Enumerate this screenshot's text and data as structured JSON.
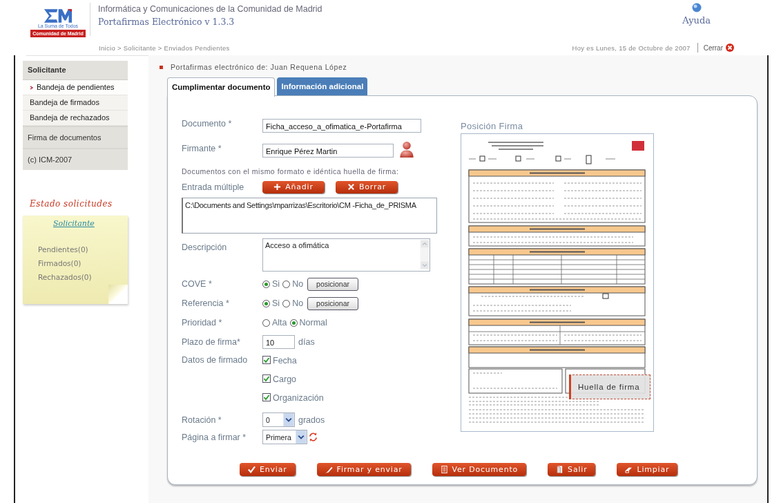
{
  "header": {
    "logo_tagline": "La Suma de Todos",
    "logo_caption": "Comunidad de Madrid",
    "org_title": "Informática y Comunicaciones de la Comunidad de Madrid",
    "app_title": "Portafirmas Electrónico v 1.3.3",
    "help": "Ayuda",
    "breadcrumb": "Inicio > Solicitante > Enviados Pendientes",
    "date": "Hoy es Lunes, 15 de Octubre de 2007",
    "close": "Cerrar"
  },
  "sidebar": {
    "menu": {
      "heading": "Solicitante",
      "items": [
        {
          "label": "Bandeja de pendientes",
          "selected": true
        },
        {
          "label": "Bandeja de firmados",
          "selected": false
        },
        {
          "label": "Bandeja de rechazados",
          "selected": false
        }
      ]
    },
    "sections": [
      "Firma de documentos",
      "(c) ICM-2007"
    ],
    "status": {
      "title": "Estado solicitudes",
      "heading": "Solicitante",
      "items": [
        "Pendientes(0)",
        "Firmados(0)",
        "Rechazados(0)"
      ]
    }
  },
  "owner": "Portafirmas electrónico de: Juan Requena López",
  "tabs": [
    {
      "label": "Cumplimentar documento",
      "selected": true
    },
    {
      "label": "Información adicional",
      "selected": false
    }
  ],
  "form": {
    "rows": [
      {
        "kind": "text",
        "label": "Documento *",
        "value": "Ficha_acceso_a_ofimatica_e-Portafirma"
      },
      {
        "kind": "person",
        "label": "Firmante *",
        "value": "Enrique Pérez Martin"
      },
      {
        "kind": "note",
        "text": "Documentos con el mismo formato e idéntica huella de firma:"
      },
      {
        "kind": "actions",
        "label": "Entrada múltiple",
        "buttons": [
          {
            "label": "Añadir"
          },
          {
            "label": "Borrar"
          }
        ]
      },
      {
        "kind": "list",
        "value": "C:\\Documents and Settings\\mparrizas\\Escritorio\\CM -Ficha_de_PRISMA"
      },
      {
        "kind": "textarea",
        "label": "Descripción",
        "value": "Acceso a ofimática"
      },
      {
        "kind": "radio",
        "label": "COVE *",
        "options": [
          {
            "label": "Si",
            "selected": true
          },
          {
            "label": "No",
            "selected": false
          }
        ],
        "button": "posicionar"
      },
      {
        "kind": "radio",
        "label": "Referencia *",
        "options": [
          {
            "label": "Si",
            "selected": true
          },
          {
            "label": "No",
            "selected": false
          }
        ],
        "button": "posicionar"
      },
      {
        "kind": "radio",
        "label": "Prioridad *",
        "options": [
          {
            "label": "Alta",
            "selected": false
          },
          {
            "label": "Normal",
            "selected": true
          }
        ]
      },
      {
        "kind": "number",
        "label": "Plazo de firma*",
        "value": "10",
        "unit": "días"
      },
      {
        "kind": "checks",
        "label": "Datos de firmado",
        "options": [
          {
            "label": "Fecha",
            "checked": true
          },
          {
            "label": "Cargo",
            "checked": true
          },
          {
            "label": "Organización",
            "checked": true
          }
        ]
      },
      {
        "kind": "select",
        "label": "Rotación *",
        "value": "0",
        "unit": "grados"
      },
      {
        "kind": "select",
        "label": "Página a firmar *",
        "value": "Primera",
        "refresh": true
      }
    ]
  },
  "preview": {
    "title": "Posición Firma",
    "stamp": "Huella de firma"
  },
  "buttons": [
    {
      "label": "Enviar"
    },
    {
      "label": "Firmar y enviar"
    },
    {
      "label": "Ver Documento"
    },
    {
      "label": "Salir"
    },
    {
      "label": "Limpiar"
    }
  ]
}
